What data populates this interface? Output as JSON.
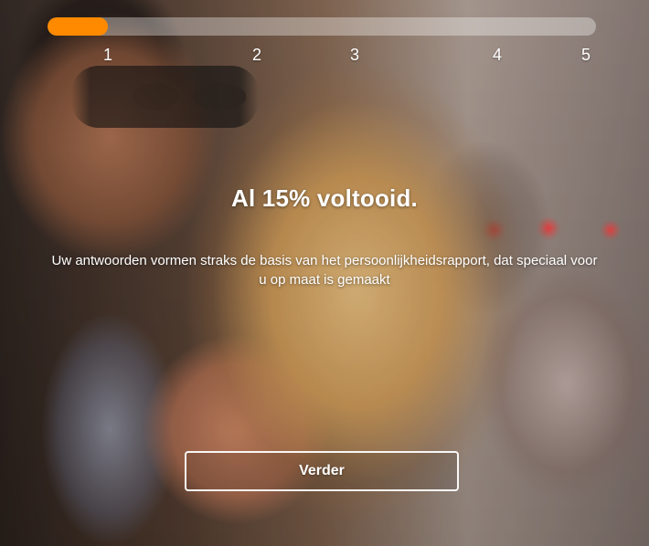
{
  "progress": {
    "percent": 15,
    "steps": [
      "1",
      "2",
      "3",
      "4",
      "5"
    ],
    "accent_color": "#ff8a00"
  },
  "content": {
    "headline": "Al 15% voltooid.",
    "body": "Uw antwoorden vormen straks de basis van het persoonlijkheidsrapport, dat speciaal voor u op maat is gemaakt"
  },
  "actions": {
    "continue_label": "Verder"
  }
}
